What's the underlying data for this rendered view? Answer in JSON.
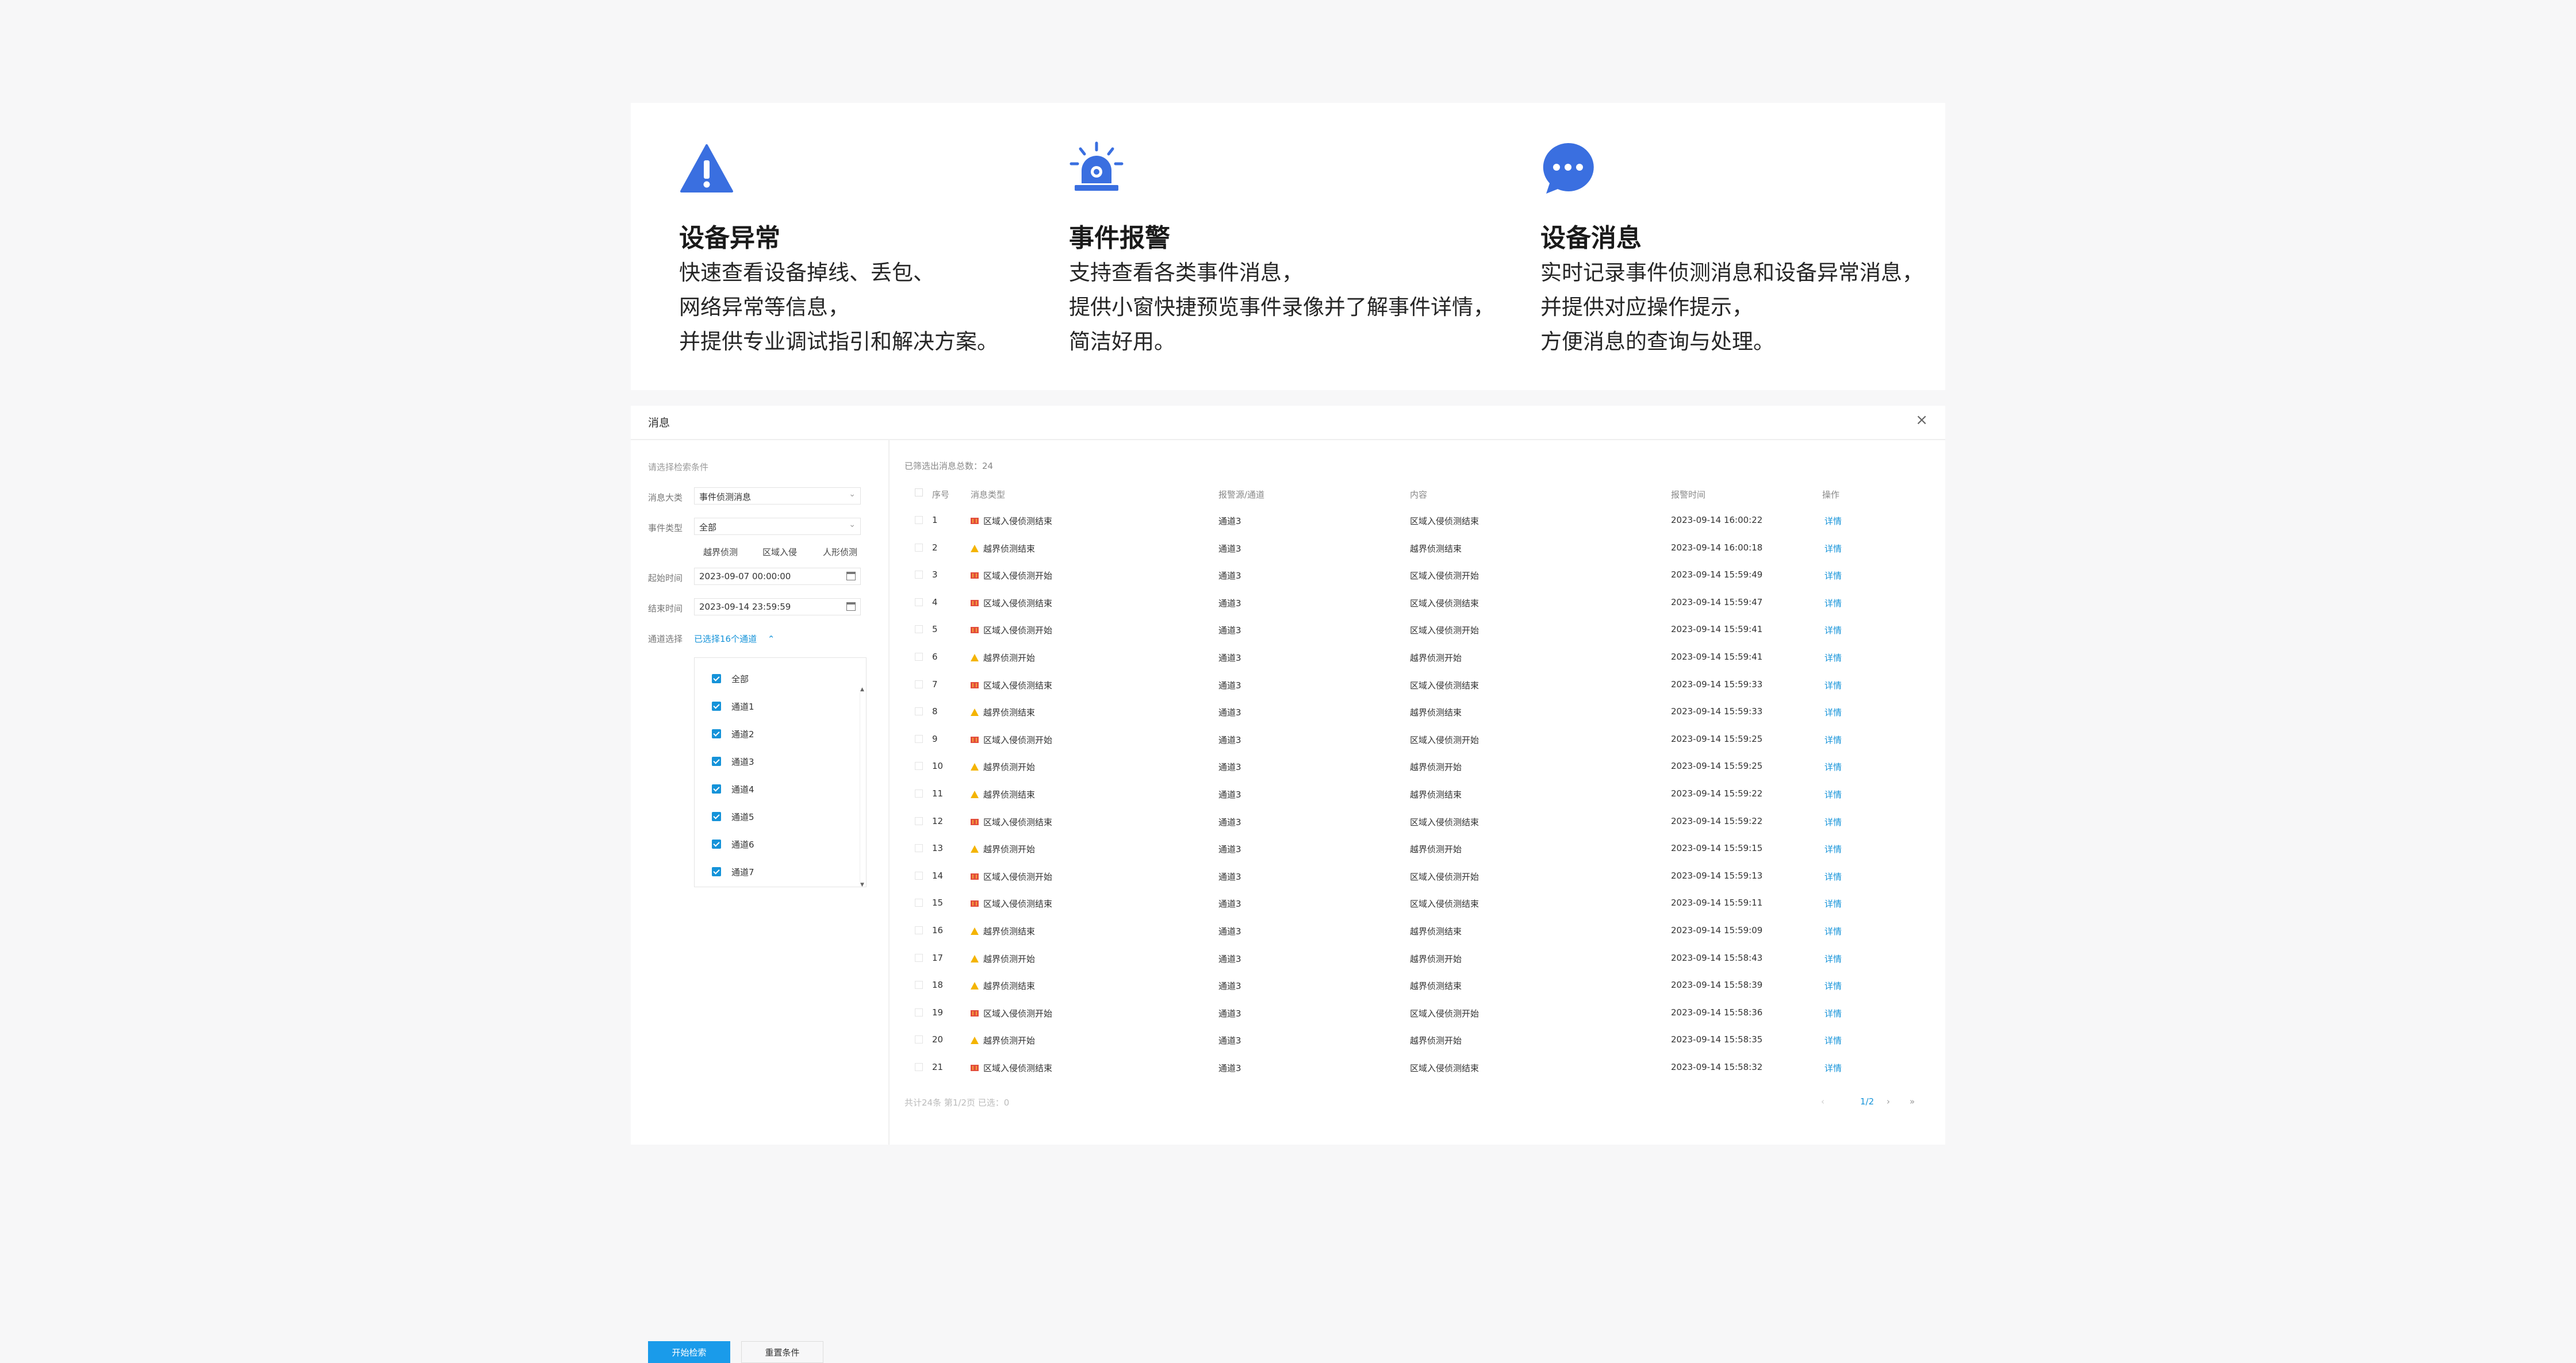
{
  "features": [
    {
      "icon": "warning-icon",
      "title": "设备异常",
      "lines": [
        "快速查看设备掉线、丢包、",
        "网络异常等信息，",
        "并提供专业调试指引和解决方案。"
      ]
    },
    {
      "icon": "alarm-light-icon",
      "title": "事件报警",
      "lines": [
        "支持查看各类事件消息，",
        "提供小窗快捷预览事件录像并了解事件详情，",
        "简洁好用。"
      ]
    },
    {
      "icon": "chat-bubble-icon",
      "title": "设备消息",
      "lines": [
        "实时记录事件侦测消息和设备异常消息，",
        "并提供对应操作提示，",
        "方便消息的查询与处理。"
      ]
    }
  ],
  "colors": {
    "accent": "#1a9bea",
    "link": "#1593d9",
    "icon_blue": "#3a6fe0",
    "intrusion_icon": "#e24d3c",
    "boundary_icon": "#f4b400"
  },
  "window": {
    "title": "消息",
    "close": "×"
  },
  "filter": {
    "heading": "请选择检索条件",
    "category_label": "消息大类",
    "category_value": "事件侦测消息",
    "event_type_label": "事件类型",
    "event_type_value": "全部",
    "subtypes": [
      "越界侦测",
      "区域入侵",
      "人形侦测"
    ],
    "start_label": "起始时间",
    "start_value": "2023-09-07 00:00:00",
    "end_label": "结束时间",
    "end_value": "2023-09-14 23:59:59",
    "channel_label": "通道选择",
    "channel_selected": "已选择16个通道",
    "channel_options": [
      "全部",
      "通道1",
      "通道2",
      "通道3",
      "通道4",
      "通道5",
      "通道6",
      "通道7"
    ],
    "search_button": "开始检索",
    "reset_button": "重置条件"
  },
  "results": {
    "total_text": "已筛选出消息总数：24",
    "columns": [
      "序号",
      "消息类型",
      "报警源/通道",
      "内容",
      "报警时间",
      "操作"
    ],
    "rows": [
      {
        "idx": "1",
        "icon": "intrusion-icon",
        "type": "区域入侵侦测结束",
        "channel": "通道3",
        "content": "区域入侵侦测结束",
        "time": "2023-09-14 16:00:22",
        "action": "详情"
      },
      {
        "idx": "2",
        "icon": "boundary-icon",
        "type": "越界侦测结束",
        "channel": "通道3",
        "content": "越界侦测结束",
        "time": "2023-09-14 16:00:18",
        "action": "详情"
      },
      {
        "idx": "3",
        "icon": "intrusion-icon",
        "type": "区域入侵侦测开始",
        "channel": "通道3",
        "content": "区域入侵侦测开始",
        "time": "2023-09-14 15:59:49",
        "action": "详情"
      },
      {
        "idx": "4",
        "icon": "intrusion-icon",
        "type": "区域入侵侦测结束",
        "channel": "通道3",
        "content": "区域入侵侦测结束",
        "time": "2023-09-14 15:59:47",
        "action": "详情"
      },
      {
        "idx": "5",
        "icon": "intrusion-icon",
        "type": "区域入侵侦测开始",
        "channel": "通道3",
        "content": "区域入侵侦测开始",
        "time": "2023-09-14 15:59:41",
        "action": "详情"
      },
      {
        "idx": "6",
        "icon": "boundary-icon",
        "type": "越界侦测开始",
        "channel": "通道3",
        "content": "越界侦测开始",
        "time": "2023-09-14 15:59:41",
        "action": "详情"
      },
      {
        "idx": "7",
        "icon": "intrusion-icon",
        "type": "区域入侵侦测结束",
        "channel": "通道3",
        "content": "区域入侵侦测结束",
        "time": "2023-09-14 15:59:33",
        "action": "详情"
      },
      {
        "idx": "8",
        "icon": "boundary-icon",
        "type": "越界侦测结束",
        "channel": "通道3",
        "content": "越界侦测结束",
        "time": "2023-09-14 15:59:33",
        "action": "详情"
      },
      {
        "idx": "9",
        "icon": "intrusion-icon",
        "type": "区域入侵侦测开始",
        "channel": "通道3",
        "content": "区域入侵侦测开始",
        "time": "2023-09-14 15:59:25",
        "action": "详情"
      },
      {
        "idx": "10",
        "icon": "boundary-icon",
        "type": "越界侦测开始",
        "channel": "通道3",
        "content": "越界侦测开始",
        "time": "2023-09-14 15:59:25",
        "action": "详情"
      },
      {
        "idx": "11",
        "icon": "boundary-icon",
        "type": "越界侦测结束",
        "channel": "通道3",
        "content": "越界侦测结束",
        "time": "2023-09-14 15:59:22",
        "action": "详情"
      },
      {
        "idx": "12",
        "icon": "intrusion-icon",
        "type": "区域入侵侦测结束",
        "channel": "通道3",
        "content": "区域入侵侦测结束",
        "time": "2023-09-14 15:59:22",
        "action": "详情"
      },
      {
        "idx": "13",
        "icon": "boundary-icon",
        "type": "越界侦测开始",
        "channel": "通道3",
        "content": "越界侦测开始",
        "time": "2023-09-14 15:59:15",
        "action": "详情"
      },
      {
        "idx": "14",
        "icon": "intrusion-icon",
        "type": "区域入侵侦测开始",
        "channel": "通道3",
        "content": "区域入侵侦测开始",
        "time": "2023-09-14 15:59:13",
        "action": "详情"
      },
      {
        "idx": "15",
        "icon": "intrusion-icon",
        "type": "区域入侵侦测结束",
        "channel": "通道3",
        "content": "区域入侵侦测结束",
        "time": "2023-09-14 15:59:11",
        "action": "详情"
      },
      {
        "idx": "16",
        "icon": "boundary-icon",
        "type": "越界侦测结束",
        "channel": "通道3",
        "content": "越界侦测结束",
        "time": "2023-09-14 15:59:09",
        "action": "详情"
      },
      {
        "idx": "17",
        "icon": "boundary-icon",
        "type": "越界侦测开始",
        "channel": "通道3",
        "content": "越界侦测开始",
        "time": "2023-09-14 15:58:43",
        "action": "详情"
      },
      {
        "idx": "18",
        "icon": "boundary-icon",
        "type": "越界侦测结束",
        "channel": "通道3",
        "content": "越界侦测结束",
        "time": "2023-09-14 15:58:39",
        "action": "详情"
      },
      {
        "idx": "19",
        "icon": "intrusion-icon",
        "type": "区域入侵侦测开始",
        "channel": "通道3",
        "content": "区域入侵侦测开始",
        "time": "2023-09-14 15:58:36",
        "action": "详情"
      },
      {
        "idx": "20",
        "icon": "boundary-icon",
        "type": "越界侦测开始",
        "channel": "通道3",
        "content": "越界侦测开始",
        "time": "2023-09-14 15:58:35",
        "action": "详情"
      },
      {
        "idx": "21",
        "icon": "intrusion-icon",
        "type": "区域入侵侦测结束",
        "channel": "通道3",
        "content": "区域入侵侦测结束",
        "time": "2023-09-14 15:58:32",
        "action": "详情"
      }
    ],
    "footer_text": "共计24条 第1/2页 已选：0",
    "pager": {
      "prev": "‹",
      "page": "1/2",
      "next": "›",
      "last": "»"
    }
  }
}
